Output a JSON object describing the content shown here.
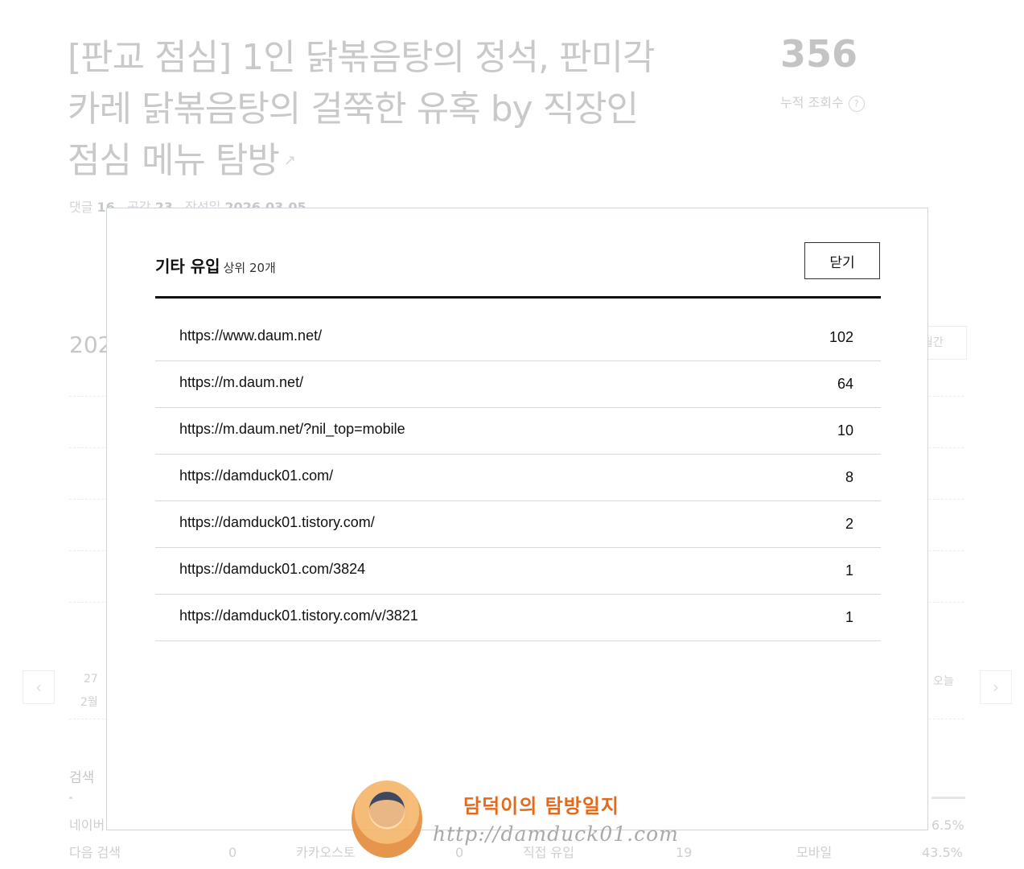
{
  "post": {
    "title": "[판교 점심] 1인 닭볶음탕의 정석, 판미각 카레 닭볶음탕의 걸쭉한 유혹 by 직장인 점심 메뉴 탐방",
    "link_icon": "external-link-icon",
    "views": "356",
    "views_label": "누적 조회수",
    "help_glyph": "?",
    "comments_label": "댓글",
    "comments": "16",
    "likes_label": "공감",
    "likes": "23",
    "date_label": "작성일",
    "date": "2026.03.05"
  },
  "chart_peek": {
    "year_fragment": "202",
    "period_fragment": "월간",
    "day": "27",
    "month": "2월",
    "today": "오늘",
    "prev_glyph": "‹",
    "next_glyph": "›"
  },
  "sources": {
    "heading": "검색",
    "naver_fragment": "네이버",
    "naver_pct_fragment": "6.5%",
    "daum_label": "다음 검색",
    "daum_value": "0",
    "kakao_label": "카카오스토",
    "kakao_value": "0",
    "direct_label": "직접 유입",
    "direct_value": "19",
    "mobile_label": "모바일",
    "mobile_pct": "43.5%"
  },
  "modal": {
    "title": "기타 유입",
    "subtitle": "상위 20개",
    "close_label": "닫기",
    "rows": [
      {
        "url": "https://www.daum.net/",
        "count": "102"
      },
      {
        "url": "https://m.daum.net/",
        "count": "64"
      },
      {
        "url": "https://m.daum.net/?nil_top=mobile",
        "count": "10"
      },
      {
        "url": "https://damduck01.com/",
        "count": "8"
      },
      {
        "url": "https://damduck01.tistory.com/",
        "count": "2"
      },
      {
        "url": "https://damduck01.com/3824",
        "count": "1"
      },
      {
        "url": "https://damduck01.tistory.com/v/3821",
        "count": "1"
      }
    ]
  },
  "watermark": {
    "name": "담덕이의 탐방일지",
    "url": "http://damduck01.com"
  }
}
